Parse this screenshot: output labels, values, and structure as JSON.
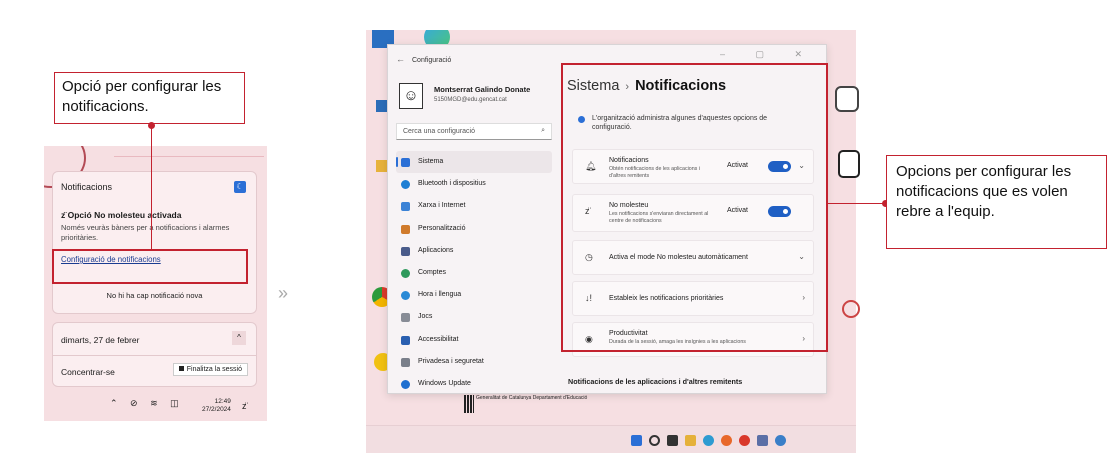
{
  "left_panel": {
    "callout": "Opció per configurar les notificacions.",
    "notifications_card": {
      "title": "Notificacions",
      "dnd_title": "Opció No molesteu activada",
      "dnd_text": "Només veuràs bàners per a notificacions i alarmes prioritàries.",
      "settings_link": "Configuració de notificacions",
      "empty_text": "No hi ha cap notificació nova"
    },
    "calendar": {
      "date": "dimarts, 27 de febrer",
      "focus": "Concentrar-se",
      "end_session": "Finalitza la sessió"
    },
    "tray": {
      "time": "12:49",
      "date": "27/2/2024"
    }
  },
  "separator_glyph": "»",
  "settings_window": {
    "title": "Configuració",
    "user": {
      "name": "Montserrat Galindo Donate",
      "email": "5150MGD@edu.gencat.cat"
    },
    "search_placeholder": "Cerca una configuració",
    "nav": [
      {
        "label": "Sistema",
        "color": "#2b6fd6",
        "active": true
      },
      {
        "label": "Bluetooth i dispositius",
        "color": "#1f7fd4"
      },
      {
        "label": "Xarxa i Internet",
        "color": "#3b82d6"
      },
      {
        "label": "Personalització",
        "color": "#d07a2b"
      },
      {
        "label": "Aplicacions",
        "color": "#4a5b8a"
      },
      {
        "label": "Comptes",
        "color": "#2f9a5c"
      },
      {
        "label": "Hora i llengua",
        "color": "#2b8ad6"
      },
      {
        "label": "Jocs",
        "color": "#888c96"
      },
      {
        "label": "Accessibilitat",
        "color": "#2a5fb0"
      },
      {
        "label": "Privadesa i seguretat",
        "color": "#7a7f8a"
      },
      {
        "label": "Windows Update",
        "color": "#1f6fd0"
      }
    ],
    "breadcrumb": {
      "parent": "Sistema",
      "separator": "›",
      "current": "Notificacions"
    },
    "org_notice": "L'organització administra algunes d'aquestes opcions de configuració.",
    "cards": [
      {
        "title": "Notificacions",
        "desc": "Obtén notificacions de les aplicacions i d'altres remitents",
        "state": "Activat",
        "icon": "bell-icon"
      },
      {
        "title": "No molesteu",
        "desc": "Les notificacions s'enviaran directament al centre de notificacions",
        "state": "Activat",
        "icon": "bell-z-icon"
      },
      {
        "title": "Activa el mode No molesteu automàticament",
        "icon": "clock-icon"
      },
      {
        "title": "Estableix les notificacions prioritàries",
        "icon": "priority-icon"
      },
      {
        "title": "Productivitat",
        "desc": "Durada de la sessió, amaga les insígnies a les aplicacions",
        "icon": "target-icon"
      }
    ],
    "section_footer": "Notificacions de les aplicacions i d'altres remitents"
  },
  "right_callout": "Opcions per configurar les notificacions que es volen rebre a l'equip.",
  "desktop_brand": {
    "gencat": "Generalitat de Catalunya Departament d'Educació"
  }
}
